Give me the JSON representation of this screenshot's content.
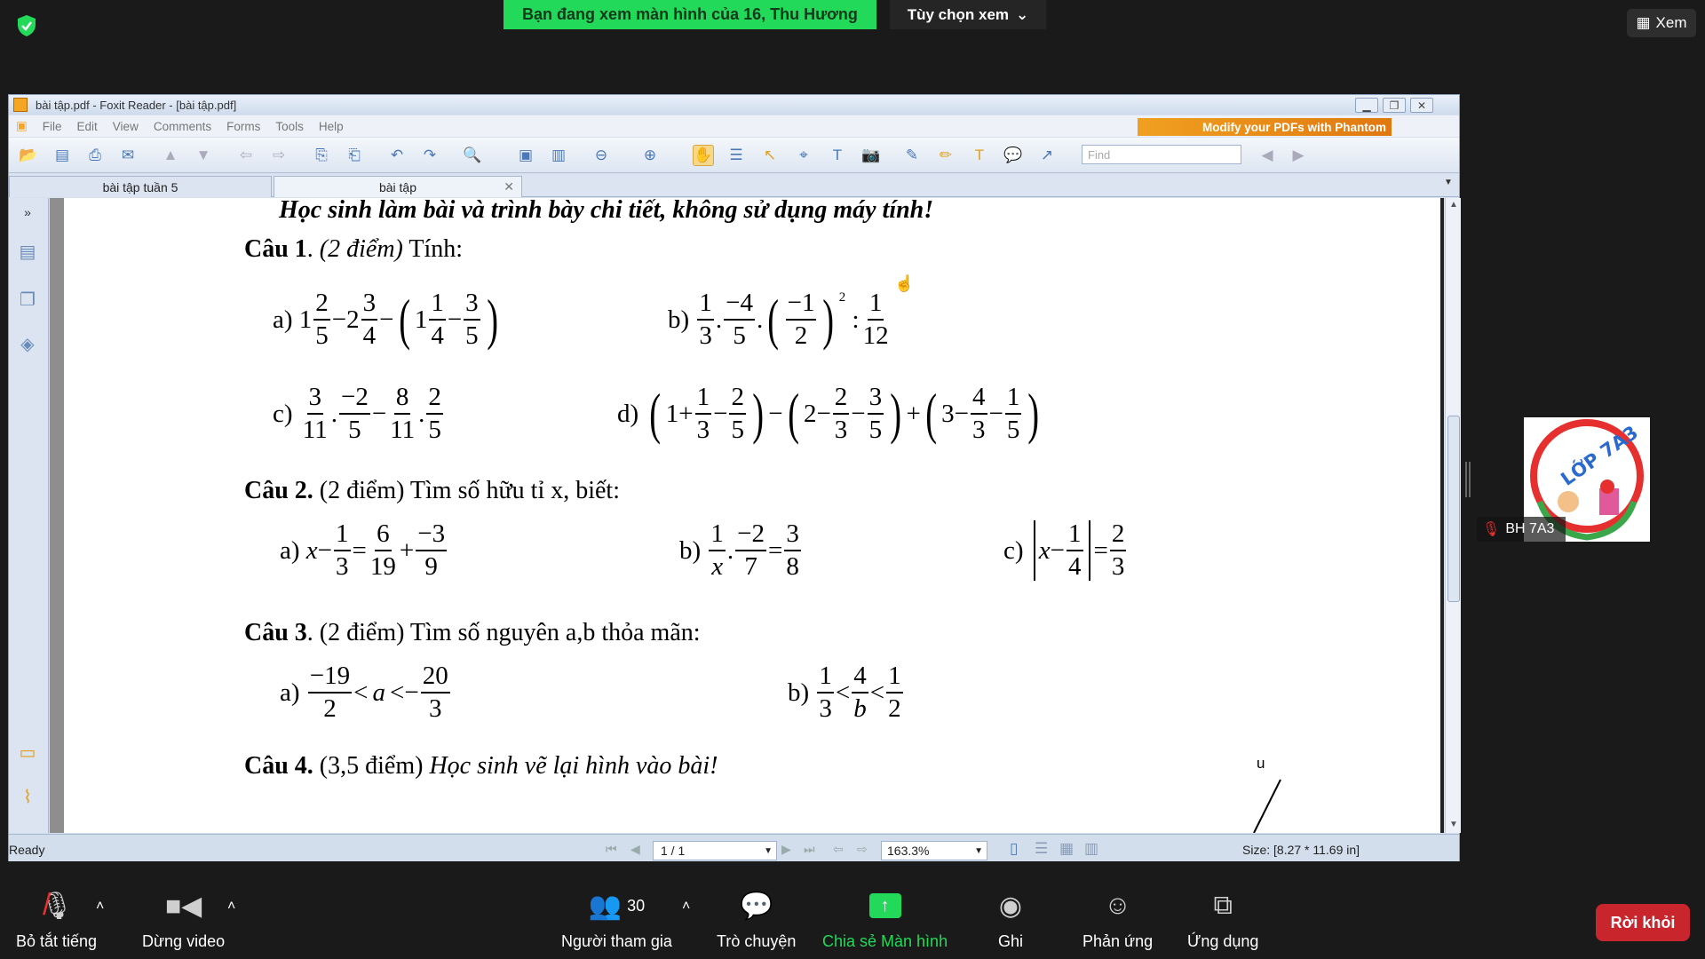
{
  "zoom_top": {
    "share_banner": "Bạn đang xem màn hình của 16, Thu Hương",
    "view_options": "Tùy chọn xem",
    "view_button": "Xem"
  },
  "foxit": {
    "title": "bài tập.pdf - Foxit Reader - [bài tập.pdf]",
    "menu": [
      "File",
      "Edit",
      "View",
      "Comments",
      "Forms",
      "Tools",
      "Help"
    ],
    "ad": "Modify your PDFs with Phantom",
    "find_placeholder": "Find",
    "tabs": [
      "bài tập tuần 5",
      "bài tập"
    ],
    "status": {
      "ready": "Ready",
      "page": "1 / 1",
      "zoom": "163.3%",
      "size": "Size: [8.27 * 11.69 in]"
    }
  },
  "document": {
    "intro": "Học sinh làm bài và trình bày chi tiết, không sử dụng máy tính!",
    "q1": {
      "head": "Câu 1",
      "points": "(2 điểm)",
      "text": "Tính:"
    },
    "q2": {
      "head": "Câu 2.",
      "text": "(2 điểm) Tìm số hữu tỉ x, biết:"
    },
    "q3": {
      "head": "Câu 3",
      "text": ". (2 điểm) Tìm số nguyên a,b thỏa mãn:"
    },
    "q4": {
      "head": "Câu 4.",
      "points": "(3,5 điểm)",
      "text": "Học sinh vẽ lại hình vào bài!"
    },
    "figure_label": "u"
  },
  "zoom_bottom": {
    "mute": "Bỏ tắt tiếng",
    "video": "Dừng video",
    "participants": "Người tham gia",
    "participants_count": "30",
    "chat": "Trò chuyện",
    "share": "Chia sẻ Màn hình",
    "record": "Ghi",
    "reactions": "Phản ứng",
    "apps": "Ứng dụng",
    "leave": "Rời khỏi"
  },
  "participant": {
    "name": "BH 7A3",
    "logo_text": "LỚP 7A3"
  },
  "colors": {
    "share_green": "#23d959",
    "leave_red": "#c9252d"
  }
}
